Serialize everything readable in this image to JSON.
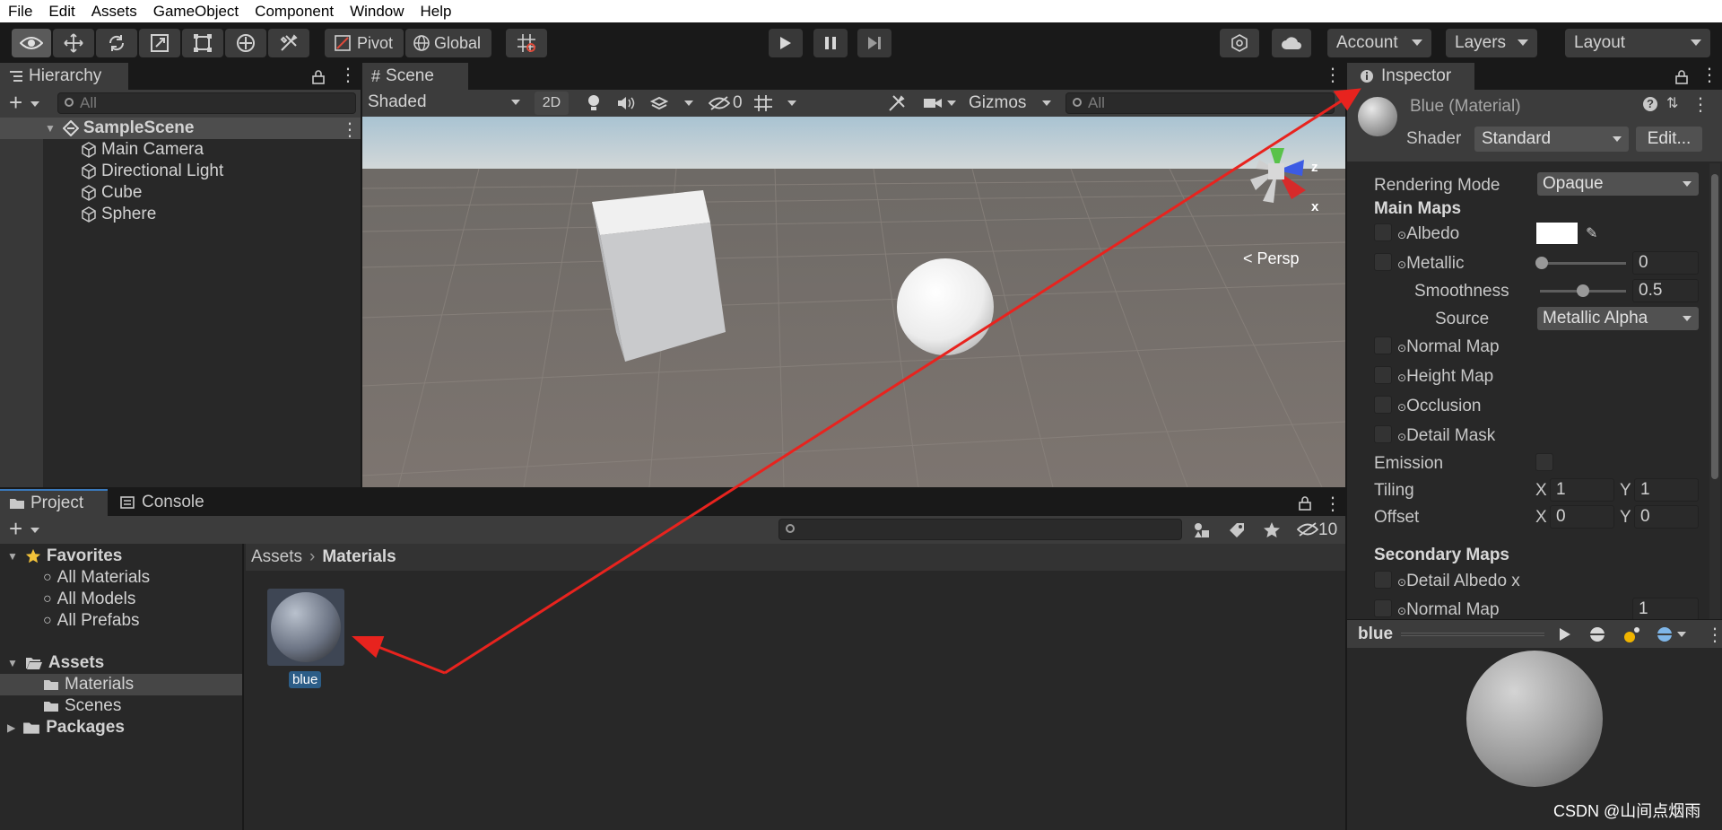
{
  "menu": [
    "File",
    "Edit",
    "Assets",
    "GameObject",
    "Component",
    "Window",
    "Help"
  ],
  "toolbar": {
    "pivot_label": "Pivot",
    "global_label": "Global",
    "account_label": "Account",
    "layers_label": "Layers",
    "layout_label": "Layout"
  },
  "hierarchy": {
    "tab_label": "Hierarchy",
    "search_placeholder": "All",
    "scene_name": "SampleScene",
    "items": [
      "Main Camera",
      "Directional Light",
      "Cube",
      "Sphere"
    ]
  },
  "scene": {
    "tab_label": "Scene",
    "shading_mode": "Shaded",
    "mode_2d": "2D",
    "hidden_count": "0",
    "gizmos_label": "Gizmos",
    "search_placeholder": "All",
    "persp_label": "< Persp",
    "axis_z": "z",
    "axis_x": "x"
  },
  "inspector": {
    "tab_label": "Inspector",
    "material_title": "Blue (Material)",
    "shader_label": "Shader",
    "shader_value": "Standard",
    "edit_button": "Edit...",
    "rendering_mode_label": "Rendering Mode",
    "rendering_mode_value": "Opaque",
    "main_maps_header": "Main Maps",
    "albedo": "Albedo",
    "metallic": "Metallic",
    "metallic_value": "0",
    "smoothness": "Smoothness",
    "smoothness_value": "0.5",
    "source": "Source",
    "source_value": "Metallic Alpha",
    "normal_map": "Normal Map",
    "height_map": "Height Map",
    "occlusion": "Occlusion",
    "detail_mask": "Detail Mask",
    "emission": "Emission",
    "tiling": "Tiling",
    "offset": "Offset",
    "x_label": "X",
    "y_label": "Y",
    "tiling_x": "1",
    "tiling_y": "1",
    "offset_x": "0",
    "offset_y": "0",
    "secondary_maps_header": "Secondary Maps",
    "detail_albedo": "Detail Albedo x",
    "normal_map_2": "Normal Map",
    "normal_map_2_value": "1",
    "preview_name": "blue",
    "colors": {
      "albedo": "#ffffff"
    }
  },
  "project": {
    "tab_label": "Project",
    "console_tab_label": "Console",
    "hidden_count": "10",
    "favorites_label": "Favorites",
    "favorites": [
      "All Materials",
      "All Models",
      "All Prefabs"
    ],
    "assets_label": "Assets",
    "assets_children": [
      "Materials",
      "Scenes"
    ],
    "packages_label": "Packages",
    "breadcrumb_root": "Assets",
    "breadcrumb_current": "Materials",
    "asset_name": "blue"
  },
  "watermark": "CSDN @山间点烟雨"
}
